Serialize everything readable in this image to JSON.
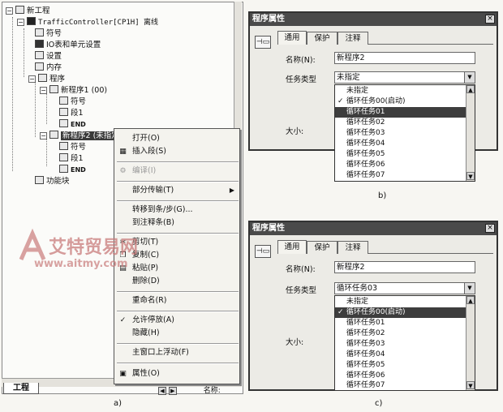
{
  "panel_a": {
    "tree": {
      "root": "新工程",
      "controller": "TrafficController[CP1H] 离线",
      "symbols": "符号",
      "io_table": "IO表和单元设置",
      "settings": "设置",
      "memory": "内存",
      "programs": "程序",
      "program1": "新程序1 (00)",
      "program1_symbols": "符号",
      "program1_section": "段1",
      "program1_end": "END",
      "program2": "新程序2 (未指定)",
      "program2_symbols": "符号",
      "program2_section": "段1",
      "program2_end": "END",
      "function_blocks": "功能块"
    },
    "tab_label": "工程",
    "status_label": "名称:",
    "context_menu": {
      "open": "打开(O)",
      "insert_section": "插入段(S)",
      "compile": "编译(I)",
      "partial_transfer": "部分传输(T)",
      "goto_step": "转移到条/步(G)...",
      "goto_comment": "到注释条(B)",
      "cut": "剪切(T)",
      "copy": "复制(C)",
      "paste": "粘贴(P)",
      "delete": "删除(D)",
      "rename": "重命名(R)",
      "allow_dock": "允许停放(A)",
      "hide": "隐藏(H)",
      "float_main": "主窗口上浮动(F)",
      "properties": "属性(O)"
    },
    "caption": "a)"
  },
  "panel_b": {
    "title": "程序属性",
    "tabs": [
      "通用",
      "保护",
      "注释"
    ],
    "name_label": "名称(N):",
    "name_value": "新程序2",
    "task_label": "任务类型",
    "task_value": "未指定",
    "size_label": "大小:",
    "list": [
      "未指定",
      "循环任务00(启动)",
      "循环任务01",
      "循环任务02",
      "循环任务03",
      "循环任务04",
      "循环任务05",
      "循环任务06",
      "循环任务07"
    ],
    "checked_index": 0,
    "highlight_index": 2,
    "caption": "b)"
  },
  "panel_c": {
    "title": "程序属性",
    "tabs": [
      "通用",
      "保护",
      "注释"
    ],
    "name_label": "名称(N):",
    "name_value": "新程序2",
    "task_label": "任务类型",
    "task_value": "循环任务03",
    "size_label": "大小:",
    "list": [
      "未指定",
      "循环任务00(启动)",
      "循环任务01",
      "循环任务02",
      "循环任务03",
      "循环任务04",
      "循环任务05",
      "循环任务06",
      "循环任务07"
    ],
    "checked_index": 1,
    "highlight_index": 1,
    "caption": "c)"
  },
  "watermark": {
    "logo": "艾特贸易网",
    "url": "www.aitmy.com"
  },
  "colors": {
    "title_bar": "#4a4a4a",
    "highlight": "#3d3d3d",
    "watermark": "#c97b7b"
  }
}
